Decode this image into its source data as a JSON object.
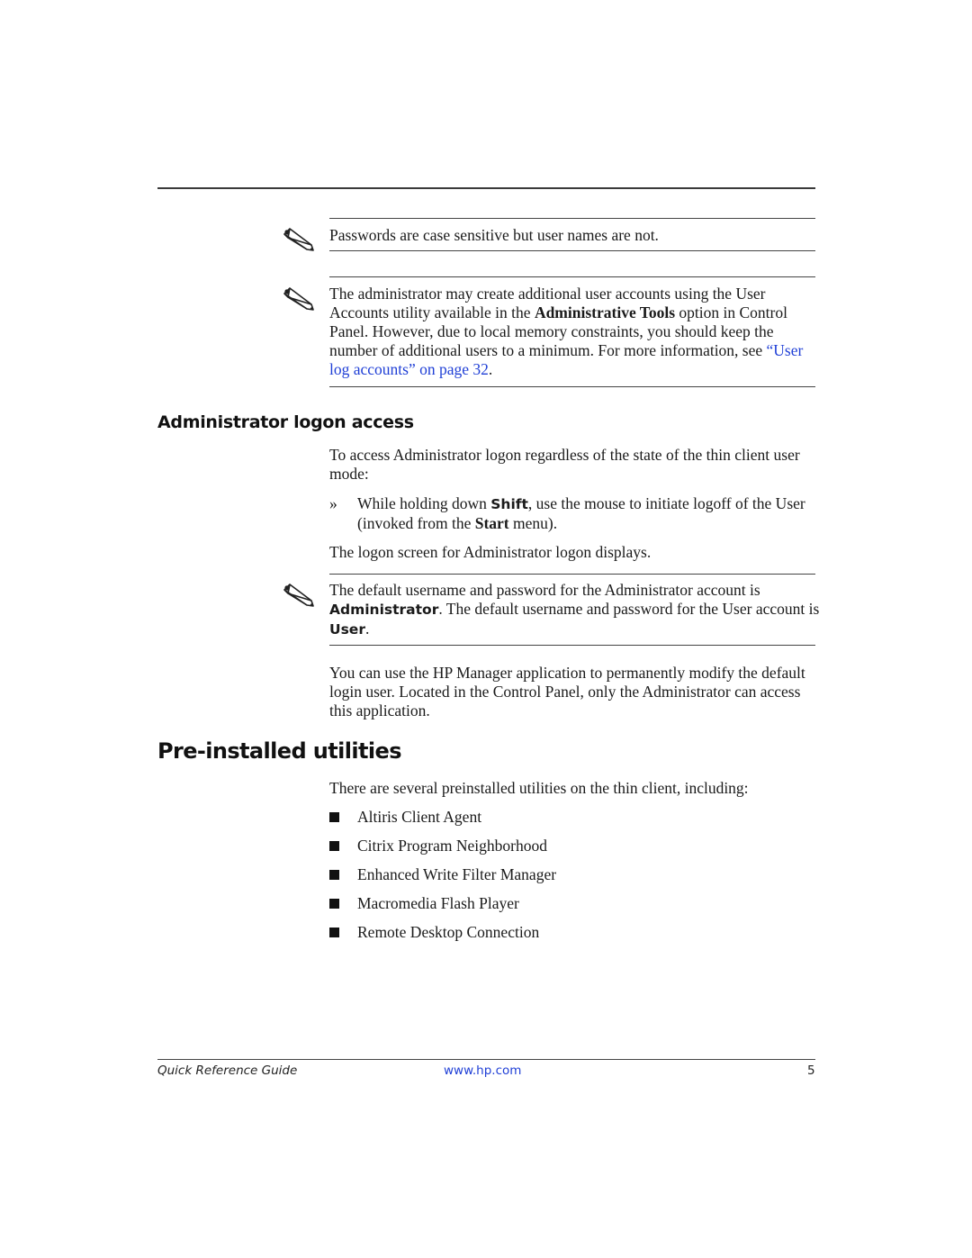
{
  "notes": [
    {
      "icon": "pencil-note-icon",
      "text": "Passwords are case sensitive but user names are not."
    },
    {
      "icon": "pencil-note-icon",
      "text_before": "The administrator may create additional user accounts using the User Accounts utility available in the ",
      "bold": "Administrative Tools",
      "text_middle": " option in Control Panel. However, due to local memory constraints, you should keep the number of additional users to a minimum. For more information, see ",
      "link": "“User log accounts” on page 32",
      "text_after": "."
    }
  ],
  "section_admin": {
    "heading": "Administrator logon access",
    "intro": "To access Administrator logon regardless of the state of the thin client user mode:",
    "step_marker": "»",
    "step_before": "While holding down ",
    "step_key": "Shift",
    "step_middle": ", use the mouse to initiate logoff of the User (invoked from the ",
    "step_menu": "Start",
    "step_after": " menu).",
    "result": "The logon screen for Administrator logon displays.",
    "note": {
      "icon": "pencil-note-icon",
      "text_before": "The default username and password for the Administrator account is ",
      "bold1": "Administrator",
      "text_middle": ". The default username and password for the User account is ",
      "bold2": "User",
      "text_after": "."
    },
    "closing": "You can use the HP Manager application to permanently modify the default login user. Located in the Control Panel, only the Administrator can access this application."
  },
  "section_utilities": {
    "heading": "Pre-installed utilities",
    "intro": "There are several preinstalled utilities on the thin client, including:",
    "items": [
      "Altiris Client Agent",
      "Citrix Program Neighborhood",
      "Enhanced Write Filter Manager",
      "Macromedia Flash Player",
      "Remote Desktop Connection"
    ]
  },
  "footer": {
    "title": "Quick Reference Guide",
    "url": "www.hp.com",
    "page_number": "5"
  },
  "colors": {
    "link": "#1f3fd6",
    "text": "#1a1a1a"
  }
}
